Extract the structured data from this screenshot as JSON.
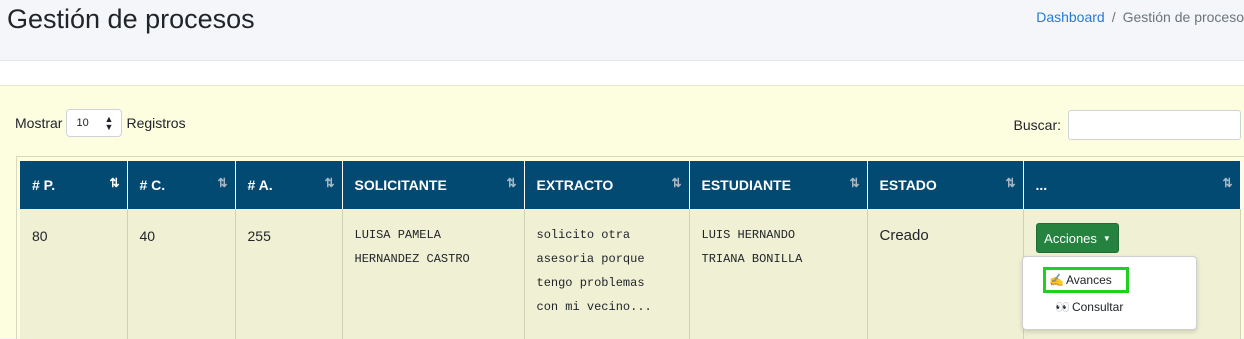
{
  "header": {
    "title": "Gestión de procesos",
    "breadcrumb": {
      "home": "Dashboard",
      "separator": "/",
      "current": "Gestión de proceso"
    }
  },
  "controls": {
    "show_label": "Mostrar",
    "page_size": "10",
    "records_label": "Registros",
    "search_label": "Buscar:",
    "search_value": ""
  },
  "table": {
    "columns": [
      "# P.",
      "# C.",
      "# A.",
      "SOLICITANTE",
      "EXTRACTO",
      "ESTUDIANTE",
      "ESTADO",
      "..."
    ],
    "rows": [
      {
        "p": "80",
        "c": "40",
        "a": "255",
        "solicitante_1": "LUISA PAMELA",
        "solicitante_2": "HERNANDEZ CASTRO",
        "extracto_1": "solicito otra",
        "extracto_2": "asesoria porque",
        "extracto_3": "tengo problemas",
        "extracto_4": "con mi vecino...",
        "estudiante_1": "LUIS HERNANDO",
        "estudiante_2": "TRIANA BONILLA",
        "estado": "Creado"
      }
    ]
  },
  "actions": {
    "button_label": "Acciones",
    "caret": "▼",
    "menu": [
      {
        "icon": "writing-hand-icon",
        "glyph": "✍",
        "label": "Avances"
      },
      {
        "icon": "eyes-icon",
        "glyph": "👀",
        "label": "Consultar"
      }
    ]
  },
  "colors": {
    "header_bg": "#034a73",
    "card_bg": "#fdfde0",
    "row_bg": "#f0f0d4",
    "action_button": "#26833f",
    "highlight_border": "#1fd11f",
    "link": "#2a7ad1"
  }
}
